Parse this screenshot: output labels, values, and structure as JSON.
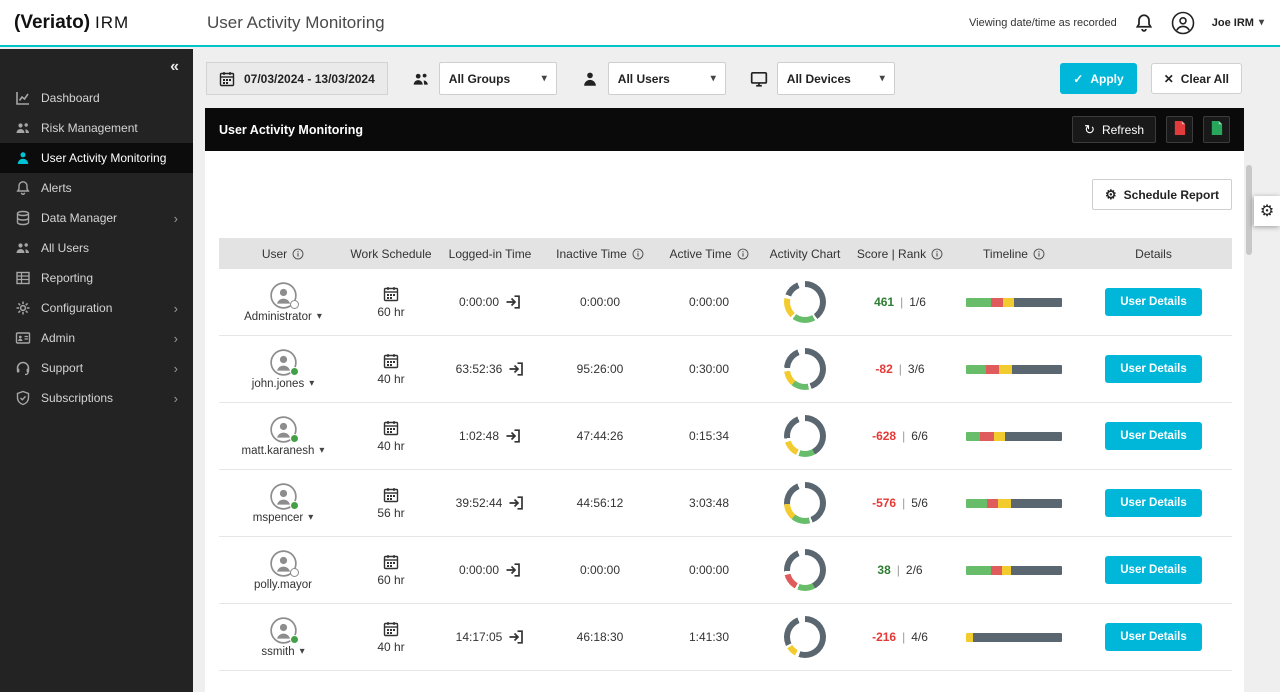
{
  "colors": {
    "accent": "#00b6d9",
    "topbar_border": "#00c4cc",
    "score_positive": "#2e7d32",
    "score_negative": "#e53935",
    "timeline_green": "#67bd6a",
    "timeline_red": "#e05b5b",
    "timeline_yellow": "#f2cb2e",
    "timeline_slate": "#5b6770"
  },
  "icons": {
    "collapse": "«",
    "chevron_right": "›",
    "caret_down": "▾",
    "check": "✓",
    "close": "✕",
    "refresh": "↻",
    "gear": "⚙"
  },
  "topbar": {
    "logo_primary": "(Veriato)",
    "logo_secondary": "IRM",
    "title": "User Activity Monitoring",
    "viewing_note": "Viewing date/time as recorded",
    "user_menu": "Joe IRM"
  },
  "sidebar": {
    "items": [
      {
        "label": "Dashboard",
        "icon": "dashboard-icon",
        "active": false,
        "chevron": false
      },
      {
        "label": "Risk Management",
        "icon": "risk-management-icon",
        "active": false,
        "chevron": false
      },
      {
        "label": "User Activity Monitoring",
        "icon": "user-activity-icon",
        "active": true,
        "chevron": false
      },
      {
        "label": "Alerts",
        "icon": "bell-icon",
        "active": false,
        "chevron": false
      },
      {
        "label": "Data Manager",
        "icon": "database-icon",
        "active": false,
        "chevron": true
      },
      {
        "label": "All Users",
        "icon": "all-users-icon",
        "active": false,
        "chevron": false
      },
      {
        "label": "Reporting",
        "icon": "reporting-icon",
        "active": false,
        "chevron": false
      },
      {
        "label": "Configuration",
        "icon": "gear-icon",
        "active": false,
        "chevron": true
      },
      {
        "label": "Admin",
        "icon": "admin-icon",
        "active": false,
        "chevron": true
      },
      {
        "label": "Support",
        "icon": "support-icon",
        "active": false,
        "chevron": true
      },
      {
        "label": "Subscriptions",
        "icon": "shield-icon",
        "active": false,
        "chevron": true
      }
    ]
  },
  "filters": {
    "date_range": "07/03/2024 - 13/03/2024",
    "groups_value": "All Groups",
    "users_value": "All Users",
    "devices_value": "All Devices",
    "apply_label": "Apply",
    "clear_label": "Clear All"
  },
  "panel": {
    "title": "User Activity Monitoring",
    "refresh_label": "Refresh",
    "schedule_report_label": "Schedule Report"
  },
  "table": {
    "details_button": "User Details",
    "headers": [
      {
        "label": "User",
        "info": true
      },
      {
        "label": "Work Schedule",
        "info": false
      },
      {
        "label": "Logged-in Time",
        "info": false
      },
      {
        "label": "Inactive Time",
        "info": true
      },
      {
        "label": "Active Time",
        "info": true
      },
      {
        "label": "Activity Chart",
        "info": false
      },
      {
        "label": "Score | Rank",
        "info": true
      },
      {
        "label": "Timeline",
        "info": true
      },
      {
        "label": "Details",
        "info": false
      }
    ],
    "rows": [
      {
        "user": "Administrator",
        "status": "offline",
        "caret": true,
        "work_schedule": "60 hr",
        "logged_in": "0:00:00",
        "inactive": "0:00:00",
        "active": "0:00:00",
        "score": "461",
        "rank": "1/6",
        "score_tone": "positive",
        "donut": [
          [
            "slate",
            40
          ],
          [
            "white",
            2
          ],
          [
            "green",
            18
          ],
          [
            "white",
            2
          ],
          [
            "yellow",
            16
          ],
          [
            "white",
            3
          ],
          [
            "slate",
            13
          ],
          [
            "white",
            6
          ]
        ],
        "timeline": [
          [
            "green",
            26
          ],
          [
            "red",
            13
          ],
          [
            "yellow",
            11
          ],
          [
            "slate",
            50
          ]
        ]
      },
      {
        "user": "john.jones",
        "status": "online",
        "caret": true,
        "work_schedule": "40 hr",
        "logged_in": "63:52:36",
        "inactive": "95:26:00",
        "active": "0:30:00",
        "score": "-82",
        "rank": "3/6",
        "score_tone": "negative",
        "donut": [
          [
            "slate",
            45
          ],
          [
            "white",
            2
          ],
          [
            "green",
            14
          ],
          [
            "yellow",
            12
          ],
          [
            "white",
            3
          ],
          [
            "slate",
            18
          ],
          [
            "white",
            6
          ]
        ],
        "timeline": [
          [
            "green",
            21
          ],
          [
            "red",
            13
          ],
          [
            "yellow",
            14
          ],
          [
            "slate",
            52
          ]
        ]
      },
      {
        "user": "matt.karanesh",
        "status": "online",
        "caret": true,
        "work_schedule": "40 hr",
        "logged_in": "1:02:48",
        "inactive": "47:44:26",
        "active": "0:15:34",
        "score": "-628",
        "rank": "6/6",
        "score_tone": "negative",
        "donut": [
          [
            "slate",
            42
          ],
          [
            "green",
            13
          ],
          [
            "white",
            2
          ],
          [
            "yellow",
            13
          ],
          [
            "white",
            3
          ],
          [
            "slate",
            21
          ],
          [
            "white",
            6
          ]
        ],
        "timeline": [
          [
            "green",
            15
          ],
          [
            "red",
            14
          ],
          [
            "yellow",
            12
          ],
          [
            "slate",
            59
          ]
        ]
      },
      {
        "user": "mspencer",
        "status": "online",
        "caret": true,
        "work_schedule": "56 hr",
        "logged_in": "39:52:44",
        "inactive": "44:56:12",
        "active": "3:03:48",
        "score": "-576",
        "rank": "5/6",
        "score_tone": "negative",
        "donut": [
          [
            "slate",
            44
          ],
          [
            "white",
            2
          ],
          [
            "green",
            15
          ],
          [
            "yellow",
            13
          ],
          [
            "slate",
            20
          ],
          [
            "white",
            6
          ]
        ],
        "timeline": [
          [
            "green",
            22
          ],
          [
            "red",
            11
          ],
          [
            "yellow",
            14
          ],
          [
            "slate",
            53
          ]
        ]
      },
      {
        "user": "polly.mayor",
        "status": "offline",
        "caret": false,
        "work_schedule": "60 hr",
        "logged_in": "0:00:00",
        "inactive": "0:00:00",
        "active": "0:00:00",
        "score": "38",
        "rank": "2/6",
        "score_tone": "positive",
        "donut": [
          [
            "slate",
            42
          ],
          [
            "green",
            14
          ],
          [
            "white",
            2
          ],
          [
            "red",
            13
          ],
          [
            "white",
            3
          ],
          [
            "slate",
            20
          ],
          [
            "white",
            6
          ]
        ],
        "timeline": [
          [
            "green",
            26
          ],
          [
            "red",
            12
          ],
          [
            "yellow",
            9
          ],
          [
            "slate",
            53
          ]
        ]
      },
      {
        "user": "ssmith",
        "status": "online",
        "caret": true,
        "work_schedule": "40 hr",
        "logged_in": "14:17:05",
        "inactive": "46:18:30",
        "active": "1:41:30",
        "score": "-216",
        "rank": "4/6",
        "score_tone": "negative",
        "donut": [
          [
            "slate",
            55
          ],
          [
            "white",
            3
          ],
          [
            "yellow",
            8
          ],
          [
            "white",
            2
          ],
          [
            "slate",
            26
          ],
          [
            "white",
            6
          ]
        ],
        "timeline": [
          [
            "yellow",
            7
          ],
          [
            "slate",
            93
          ]
        ]
      }
    ]
  }
}
